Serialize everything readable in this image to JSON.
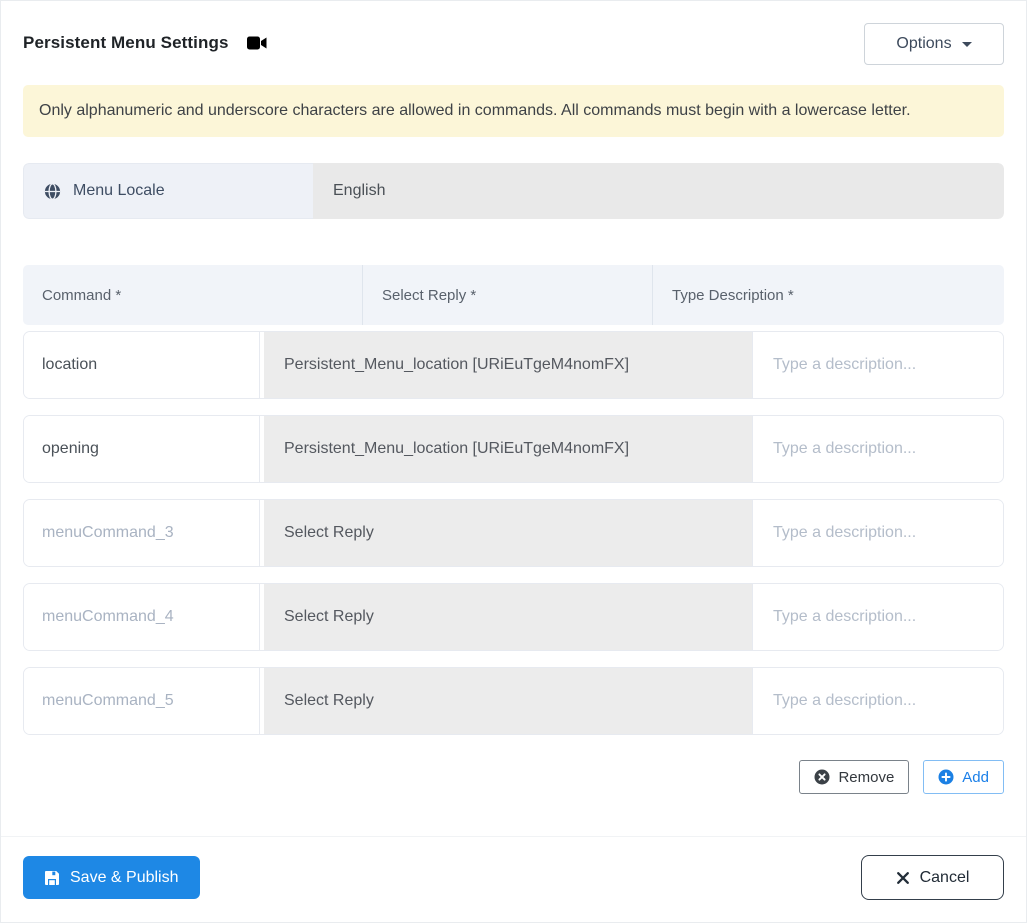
{
  "header": {
    "title": "Persistent Menu Settings",
    "options_label": "Options"
  },
  "alert": {
    "text": "Only alphanumeric and underscore characters are allowed in commands. All commands must begin with a lowercase letter."
  },
  "locale": {
    "label": "Menu Locale",
    "value": "English"
  },
  "table": {
    "headers": [
      "Command *",
      "Select Reply *",
      "Type Description *"
    ],
    "description_placeholder": "Type a description...",
    "rows": [
      {
        "command": "location",
        "reply": "Persistent_Menu_location [URiEuTgeM4nomFX]",
        "description": ""
      },
      {
        "command": "opening",
        "reply": "Persistent_Menu_location [URiEuTgeM4nomFX]",
        "description": ""
      },
      {
        "command": "menuCommand_3",
        "reply": "Select Reply",
        "description": ""
      },
      {
        "command": "menuCommand_4",
        "reply": "Select Reply",
        "description": ""
      },
      {
        "command": "menuCommand_5",
        "reply": "Select Reply",
        "description": ""
      }
    ]
  },
  "actions": {
    "remove_label": "Remove",
    "add_label": "Add"
  },
  "footer": {
    "save_label": "Save & Publish",
    "cancel_label": "Cancel"
  },
  "colors": {
    "accent_blue": "#1e88e5",
    "alert_bg": "#fcf6d8",
    "header_bg": "#f1f4f9",
    "reply_cell_bg": "#ececec",
    "icon_slate": "#3e4d63"
  }
}
